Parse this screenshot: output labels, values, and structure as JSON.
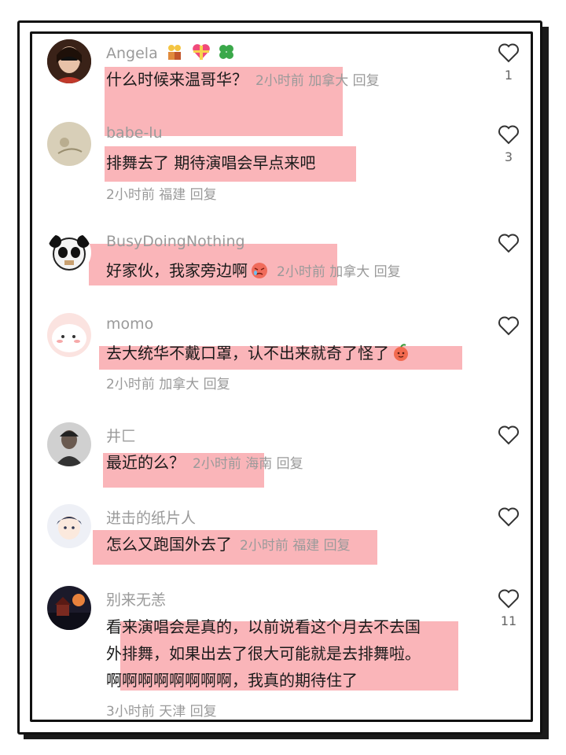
{
  "comments": [
    {
      "name": "Angela",
      "text": "什么时候来温哥华？",
      "meta": "2小时前 加拿大 回复",
      "likes": "1",
      "name_icons": [
        "couple-emoji",
        "gift-heart-emoji",
        "clover-emoji"
      ]
    },
    {
      "name": "babe-lu",
      "text": "排舞去了  期待演唱会早点来吧",
      "meta": "2小时前 福建 回复",
      "likes": "3"
    },
    {
      "name": "BusyDoingNothing",
      "text": "好家伙，我家旁边啊",
      "meta": "2小时前 加拿大 回复",
      "likes": "",
      "text_icon": "crying-face-emoji"
    },
    {
      "name": "momo",
      "text": "去大统华不戴口罩，认不出来就奇了怪了",
      "meta": "2小时前 加拿大 回复",
      "likes": "",
      "text_icon": "peach-face-emoji"
    },
    {
      "name": "井匚",
      "text": "最近的么？",
      "meta": "2小时前 海南 回复",
      "likes": ""
    },
    {
      "name": "进击的纸片人",
      "text": "怎么又跑国外去了",
      "meta": "2小时前 福建 回复",
      "likes": ""
    },
    {
      "name": "别来无恙",
      "text_lines": [
        "看来演唱会是真的，以前说看这个月去不去国",
        "外排舞，如果出去了很大可能就是去排舞啦。",
        "啊啊啊啊啊啊啊啊，我真的期待住了"
      ],
      "meta": "3小时前 天津 回复",
      "likes": "11"
    }
  ],
  "colors": {
    "highlight": "#f67880",
    "text": "#1a1a1a",
    "muted": "#9a9a9a"
  }
}
